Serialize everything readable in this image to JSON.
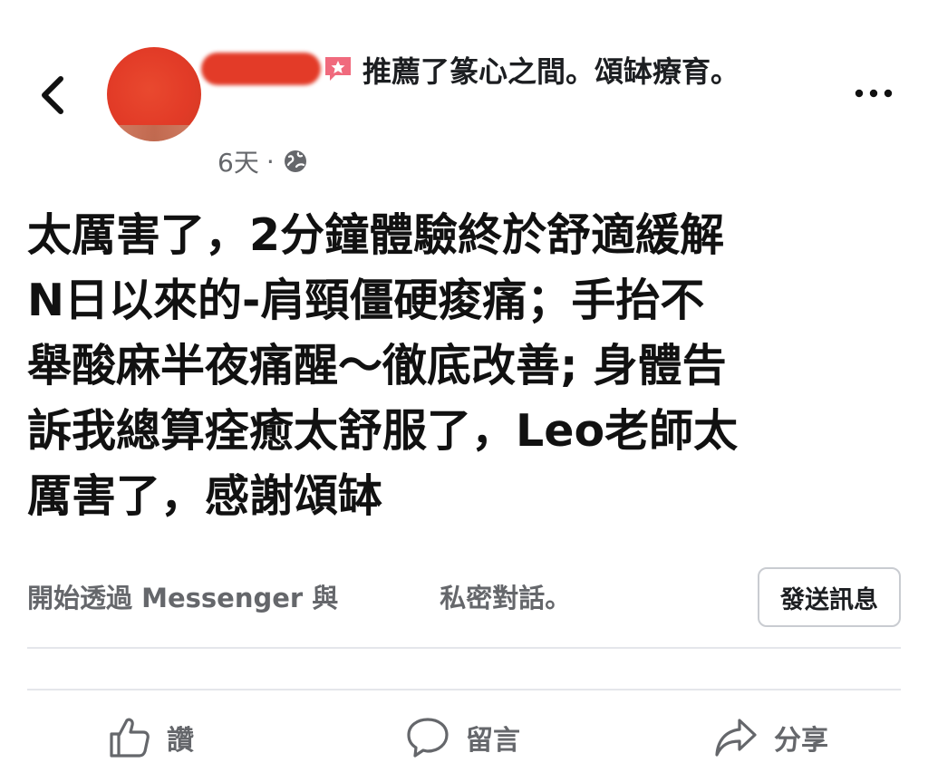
{
  "header": {
    "headline": "推薦了篆心之間。頌缽療育。",
    "time": "6天",
    "separator": "·",
    "privacy_icon": "globe-icon",
    "back_icon": "chevron-left-icon",
    "more_icon": "more-dots-icon",
    "recommend_icon": "star-badge-icon"
  },
  "post": {
    "text": "太厲害了，2分鐘體驗終於舒適緩解\nN日以來的-肩頸僵硬痠痛；手抬不\n舉酸麻半夜痛醒～徹底改善; 身體告\n訴我總算痊癒太舒服了，Leo老師太\n厲害了，感謝頌缽"
  },
  "messenger": {
    "prefix": "開始透過 Messenger 與",
    "suffix": "私密對話。",
    "button_label": "發送訊息"
  },
  "actions": {
    "like": "讚",
    "comment": "留言",
    "share": "分享"
  },
  "colors": {
    "accent_recommend": "#f06a7d",
    "secondary_text": "#65676b",
    "divider": "#e4e6eb"
  }
}
